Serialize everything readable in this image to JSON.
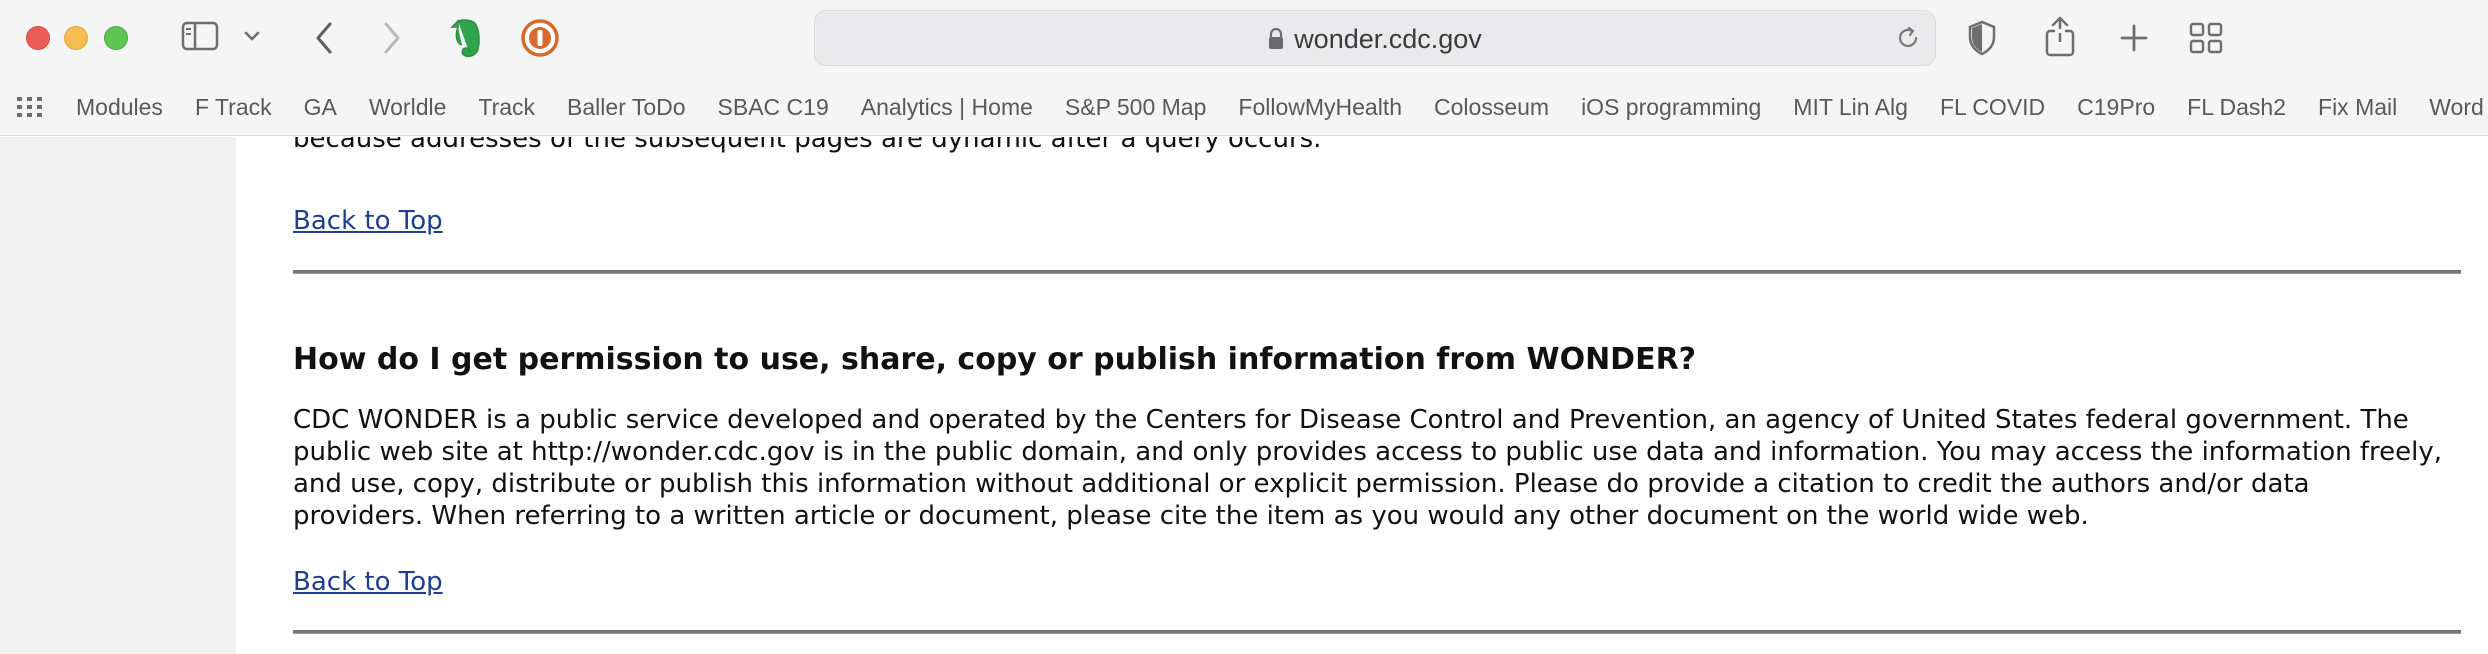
{
  "browser": {
    "url": "wonder.cdc.gov",
    "bookmarks": [
      "Modules",
      "F Track",
      "GA",
      "Worldle",
      "Track",
      "Baller ToDo",
      "SBAC C19",
      "Analytics | Home",
      "S&P 500 Map",
      "FollowMyHealth",
      "Colosseum",
      "iOS programming",
      "MIT Lin Alg",
      "FL COVID",
      "C19Pro",
      "FL Dash2",
      "Fix Mail",
      "Word Count"
    ]
  },
  "page": {
    "prev_answer_tail": "because addresses of the subsequent pages are dynamic after a query occurs.",
    "back_to_top_1": "Back to Top",
    "question": "How do I get permission to use, share, copy or publish information from WONDER?",
    "answer_lines": [
      "CDC WONDER is a public service developed and operated by the Centers for Disease Control and Prevention, an agency of United States federal government. The",
      "public web site at http://wonder.cdc.gov is in the public domain, and only provides access to public use data and information. You may access the information freely,",
      "and use, copy, distribute or publish this information without additional or explicit permission. Please do provide a citation to credit the authors and/or data",
      "providers. When referring to a written article or document, please cite the item as you would any other document on the world wide web."
    ],
    "back_to_top_2": "Back to Top"
  }
}
